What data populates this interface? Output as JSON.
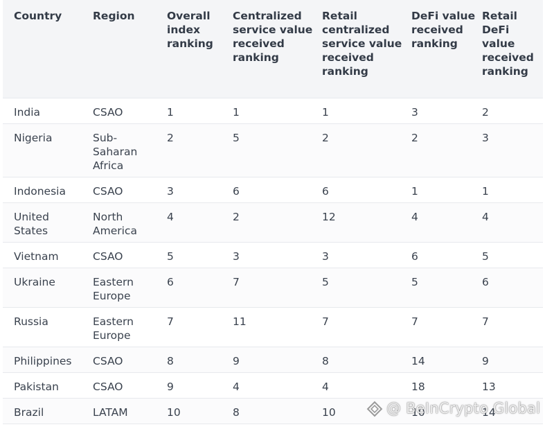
{
  "table": {
    "headers": [
      "Country",
      "Region",
      "Overall index ranking",
      "Centralized service value received ranking",
      "Retail centralized service value received ranking",
      "DeFi value received ranking",
      "Retail DeFi value received ranking"
    ],
    "rows": [
      [
        "India",
        "CSAO",
        "1",
        "1",
        "1",
        "3",
        "2"
      ],
      [
        "Nigeria",
        "Sub-Saharan Africa",
        "2",
        "5",
        "2",
        "2",
        "3"
      ],
      [
        "Indonesia",
        "CSAO",
        "3",
        "6",
        "6",
        "1",
        "1"
      ],
      [
        "United States",
        "North America",
        "4",
        "2",
        "12",
        "4",
        "4"
      ],
      [
        "Vietnam",
        "CSAO",
        "5",
        "3",
        "3",
        "6",
        "5"
      ],
      [
        "Ukraine",
        "Eastern Europe",
        "6",
        "7",
        "5",
        "5",
        "6"
      ],
      [
        "Russia",
        "Eastern Europe",
        "7",
        "11",
        "7",
        "7",
        "7"
      ],
      [
        "Philippines",
        "CSAO",
        "8",
        "9",
        "8",
        "14",
        "9"
      ],
      [
        "Pakistan",
        "CSAO",
        "9",
        "4",
        "4",
        "18",
        "13"
      ],
      [
        "Brazil",
        "LATAM",
        "10",
        "8",
        "10",
        "10",
        "14"
      ]
    ]
  },
  "watermark": {
    "text": "@ BeInCrypto Global",
    "logo_icon": "beincrypto-logo-icon"
  }
}
